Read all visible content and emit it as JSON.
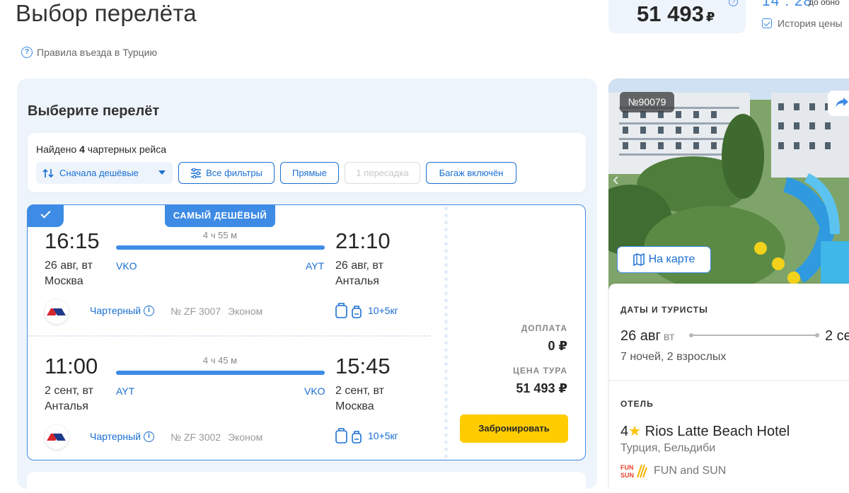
{
  "header": {
    "title": "Выбор перелёта",
    "price": "51 493",
    "currency": "₽",
    "help_icon": "question-icon",
    "timer": "14 : 28",
    "timer_note": "до обно",
    "history_label": "История цены",
    "entry_rules": "Правила въезда в Турцию"
  },
  "flights": {
    "section_title": "Выберите перелёт",
    "found_prefix": "Найдено ",
    "found_count": "4",
    "found_suffix": " чартерных рейса",
    "sort_label": "Сначала дешёвые",
    "filters": [
      {
        "label": "Все фильтры",
        "enabled": true
      },
      {
        "label": "Прямые",
        "enabled": true
      },
      {
        "label": "1 пересадка",
        "enabled": false
      },
      {
        "label": "Багаж включён",
        "enabled": true
      }
    ],
    "badge": "САМЫЙ ДЕШЁВЫЙ",
    "outbound": {
      "dep_time": "16:15",
      "dep_date": "26 авг, вт",
      "dep_city": "Москва",
      "dep_code": "VKO",
      "arr_time": "21:10",
      "arr_date": "26 авг, вт",
      "arr_city": "Анталья",
      "arr_code": "AYT",
      "duration": "4 ч 55 м",
      "type": "Чартерный",
      "flight_no": "№ ZF 3007",
      "cabin": "Эконом",
      "baggage": "10+5кг"
    },
    "return": {
      "dep_time": "11:00",
      "dep_date": "2 сент, вт",
      "dep_city": "Анталья",
      "dep_code": "AYT",
      "arr_time": "15:45",
      "arr_date": "2 сент, вт",
      "arr_city": "Москва",
      "arr_code": "VKO",
      "duration": "4 ч 45 м",
      "type": "Чартерный",
      "flight_no": "№ ZF 3002",
      "cabin": "Эконом",
      "baggage": "10+5кг"
    },
    "surcharge_label": "ДОПЛАТА",
    "surcharge_value": "0 ₽",
    "tour_price_label": "ЦЕНА ТУРА",
    "tour_price_value": "51 493 ₽",
    "book_label": "Забронировать"
  },
  "sidebar": {
    "hotel_number": "№90079",
    "map_button": "На карте",
    "dates_label": "ДАТЫ И ТУРИСТЫ",
    "date_from": "26 авг",
    "date_from_dow": "вт",
    "date_to": "2 се",
    "nights": "7 ночей, 2 взрослых",
    "hotel_label": "ОТЕЛЬ",
    "hotel_stars": "4",
    "hotel_name": "Rios Latte Beach Hotel",
    "hotel_location": "Турция,  Бельдиби",
    "operator_logo_text": "FUN SUN",
    "operator_name": "FUN and SUN"
  },
  "colors": {
    "accent": "#3e8be5",
    "link": "#1a6fd1",
    "panel_bg": "#eef4fb",
    "book_button": "#ffcc00",
    "star": "#ffc200"
  }
}
